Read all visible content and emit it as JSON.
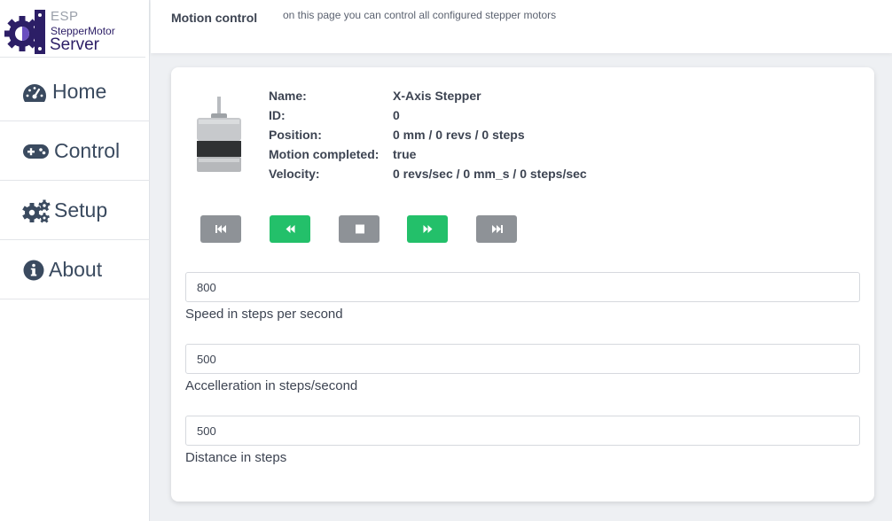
{
  "logo": {
    "line1": "ESP",
    "line2": "StepperMotor",
    "line3": "Server"
  },
  "sidebar": {
    "items": [
      {
        "label": "Home",
        "icon": "dashboard-icon"
      },
      {
        "label": "Control",
        "icon": "gamepad-icon"
      },
      {
        "label": "Setup",
        "icon": "gears-icon"
      },
      {
        "label": "About",
        "icon": "info-circle-icon"
      }
    ]
  },
  "header": {
    "title": "Motion control",
    "subtitle": "on this page you can control all configured stepper motors"
  },
  "motor": {
    "name_label": "Name:",
    "name_value": "X-Axis Stepper",
    "id_label": "ID:",
    "id_value": "0",
    "position_label": "Position:",
    "position_value": "0 mm / 0 revs / 0 steps",
    "completed_label": "Motion completed:",
    "completed_value": "true",
    "velocity_label": "Velocity:",
    "velocity_value": "0 revs/sec / 0 mm_s / 0 steps/sec"
  },
  "controls": {
    "buttons": [
      {
        "icon": "fast-backward-icon",
        "color": "#8e9297"
      },
      {
        "icon": "backward-icon",
        "color": "#23c06a"
      },
      {
        "icon": "stop-icon",
        "color": "#8e9297"
      },
      {
        "icon": "forward-icon",
        "color": "#23c06a"
      },
      {
        "icon": "fast-forward-icon",
        "color": "#8e9297"
      }
    ]
  },
  "fields": {
    "speed_value": "800",
    "speed_label": "Speed in steps per second",
    "accel_value": "500",
    "accel_label": "Accelleration in steps/second",
    "distance_value": "500",
    "distance_label": "Distance in steps"
  },
  "colors": {
    "accent_green": "#23c06a",
    "button_gray": "#8e9297",
    "logo_purple": "#2c1e66"
  }
}
